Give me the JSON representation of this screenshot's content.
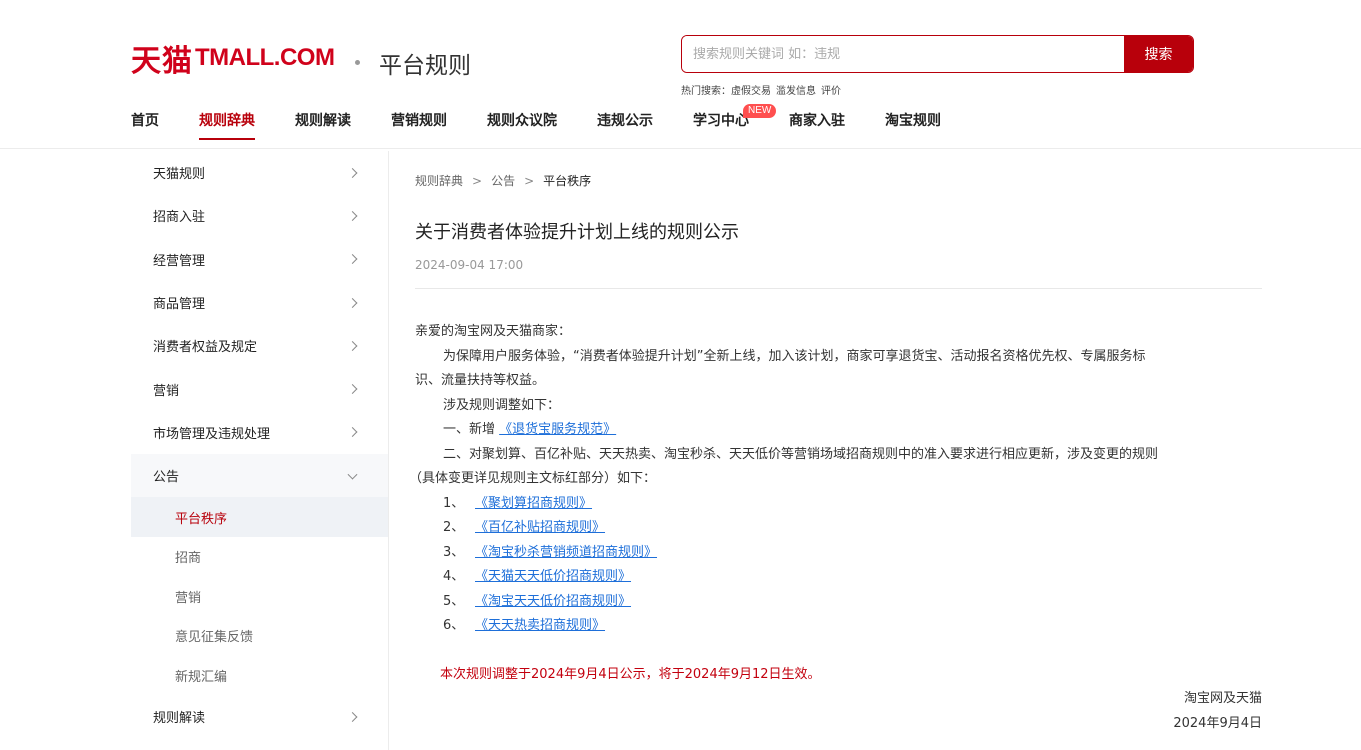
{
  "header": {
    "logo_cn": "天猫",
    "logo_en": "TMALL.COM",
    "subtitle": "平台规则",
    "search": {
      "placeholder": "搜索规则关键词 如：违规",
      "button": "搜索"
    },
    "hot": {
      "label": "热门搜索：",
      "terms": [
        "虚假交易",
        "滥发信息",
        "评价"
      ]
    },
    "nav": [
      {
        "label": "首页"
      },
      {
        "label": "规则辞典"
      },
      {
        "label": "规则解读"
      },
      {
        "label": "营销规则"
      },
      {
        "label": "规则众议院"
      },
      {
        "label": "违规公示"
      },
      {
        "label": "学习中心",
        "badge": "NEW"
      },
      {
        "label": "商家入驻"
      },
      {
        "label": "淘宝规则"
      }
    ],
    "active_nav": "规则辞典"
  },
  "sidebar": {
    "items": [
      {
        "label": "天猫规则"
      },
      {
        "label": "招商入驻"
      },
      {
        "label": "经营管理"
      },
      {
        "label": "商品管理"
      },
      {
        "label": "消费者权益及规定"
      },
      {
        "label": "营销"
      },
      {
        "label": "市场管理及违规处理"
      },
      {
        "label": "公告"
      }
    ],
    "sub_items": [
      {
        "label": "平台秩序"
      },
      {
        "label": "招商"
      },
      {
        "label": "营销"
      },
      {
        "label": "意见征集反馈"
      },
      {
        "label": "新规汇编"
      }
    ],
    "after_items": [
      {
        "label": "规则解读"
      }
    ]
  },
  "article": {
    "breadcrumb": [
      "规则辞典",
      "公告",
      "平台秩序"
    ],
    "breadcrumb_sep": ">",
    "title": "关于消费者体验提升计划上线的规则公示",
    "date": "2024-09-04 17:00",
    "greeting": "亲爱的淘宝网及天猫商家：",
    "para1": "为保障用户服务体验，“消费者体验提升计划”全新上线，加入该计划，商家可享退货宝、活动报名资格优先权、专属服务标",
    "para1b": "识、流量扶持等权益。",
    "para2": "涉及规则调整如下：",
    "item1_prefix": "一、新增 ",
    "item1_link": "《退货宝服务规范》",
    "item2": "二、对聚划算、百亿补贴、天天热卖、淘宝秒杀、天天低价等营销场域招商规则中的准入要求进行相应更新，涉及变更的规则",
    "item2b": "（具体变更详见规则主文标红部分）如下：",
    "list": [
      {
        "num": "1、",
        "link": "《聚划算招商规则》"
      },
      {
        "num": "2、",
        "link": "《百亿补贴招商规则》"
      },
      {
        "num": "3、",
        "link": "《淘宝秒杀营销频道招商规则》"
      },
      {
        "num": "4、",
        "link": "《天猫天天低价招商规则》"
      },
      {
        "num": "5、",
        "link": "《淘宝天天低价招商规则》"
      },
      {
        "num": "6、",
        "link": "《天天热卖招商规则》"
      }
    ],
    "notice": "本次规则调整于2024年9月4日公示，将于2024年9月12日生效。",
    "sign_org": "淘宝网及天猫",
    "sign_date": "2024年9月4日"
  }
}
